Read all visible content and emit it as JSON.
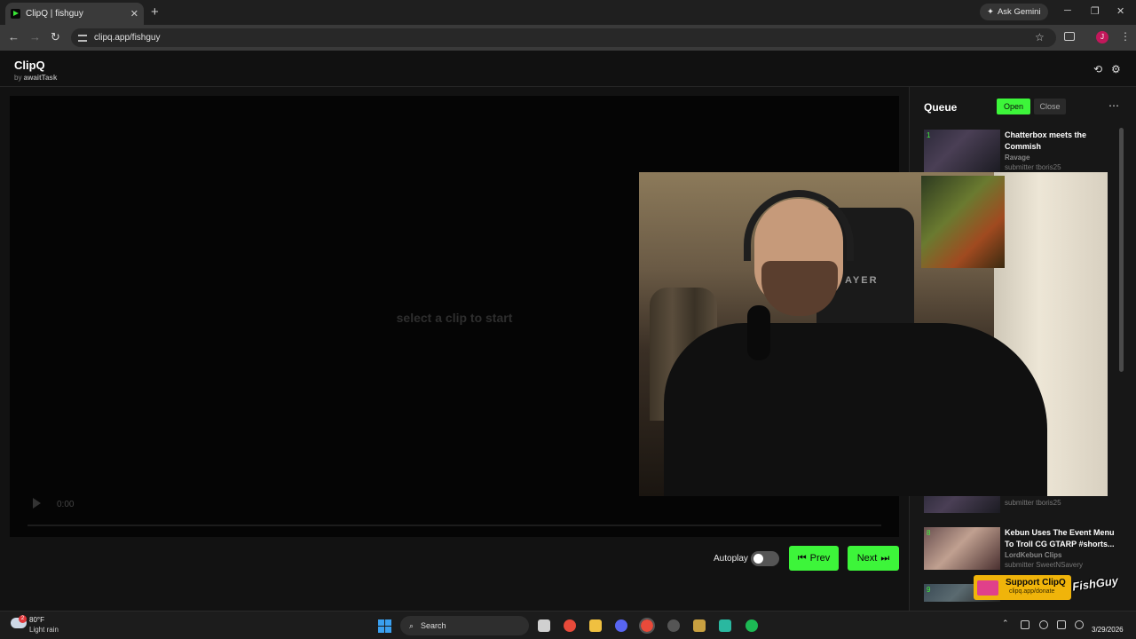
{
  "browser": {
    "tab_title": "ClipQ | fishguy",
    "url": "clipq.app/fishguy",
    "ask_gemini": "Ask Gemini",
    "profile_initial": "J"
  },
  "app": {
    "name": "ClipQ",
    "byline_prefix": "by ",
    "byline_author": "awaitTask"
  },
  "player": {
    "placeholder": "select a clip to start",
    "time": "0:00"
  },
  "controls": {
    "autoplay_label": "Autoplay",
    "autoplay_on": false,
    "prev_label": "Prev",
    "next_label": "Next"
  },
  "queue": {
    "title": "Queue",
    "open_label": "Open",
    "close_label": "Close",
    "items": [
      {
        "index": "1",
        "title": "Chatterbox meets the Commish",
        "channel": "Ravage",
        "submitter": "submitter tboris25"
      },
      {
        "submitter": "submitter tboris25"
      },
      {
        "index": "8",
        "title": "Kebun Uses The Event Menu To Troll CG GTARP #shorts...",
        "channel": "LordKebun Clips",
        "submitter": "submitter SweetNSavery"
      },
      {
        "index": "9"
      }
    ]
  },
  "overlay": {
    "chair_text": "AYER"
  },
  "support": {
    "title": "Support ClipQ",
    "url": "clipq.app/donate"
  },
  "watermark": "FishGuy",
  "taskbar": {
    "temperature": "80°F",
    "condition": "Light rain",
    "weather_badge": "2",
    "search_label": "Search",
    "date": "3/29/2026"
  },
  "colors": {
    "accent": "#3df53a",
    "panel": "#171717",
    "background": "#121212"
  }
}
